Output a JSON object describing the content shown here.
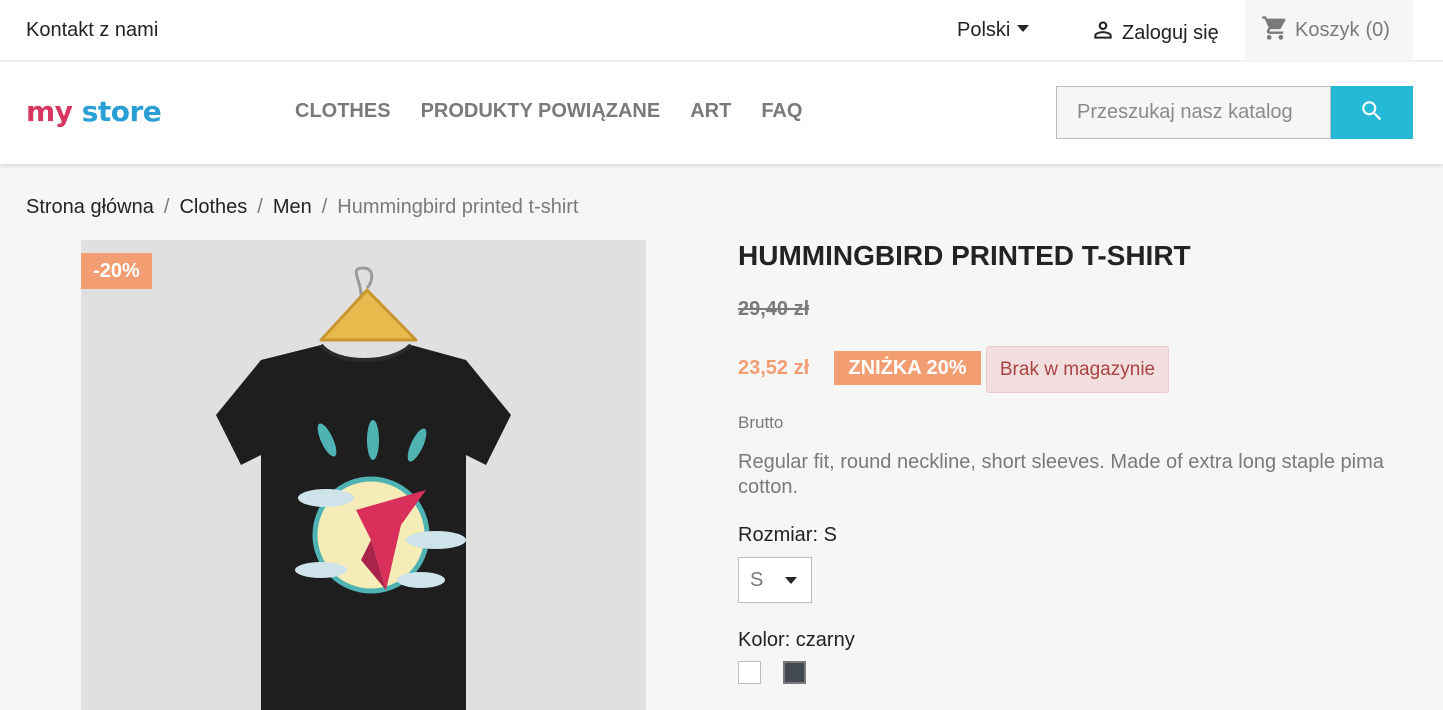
{
  "topbar": {
    "contact_label": "Kontakt z nami",
    "language": "Polski",
    "login_label": "Zaloguj się",
    "cart_label": "Koszyk",
    "cart_count": "(0)"
  },
  "header": {
    "logo": {
      "part1": "my",
      "part2": "store"
    },
    "nav": [
      "CLOTHES",
      "PRODUKTY POWIĄZANE",
      "ART",
      "FAQ"
    ],
    "search_placeholder": "Przeszukaj nasz katalog"
  },
  "breadcrumb": {
    "items": [
      "Strona główna",
      "Clothes",
      "Men"
    ],
    "current": "Hummingbird printed t-shirt",
    "separator": "/"
  },
  "product": {
    "discount_flag": "-20%",
    "title": "Hummingbird printed t-shirt",
    "old_price": "29,40 zł",
    "price": "23,52 zł",
    "save_label": "ZNIŻKA 20%",
    "stock_label": "Brak w magazynie",
    "tax_label": "Brutto",
    "description": "Regular fit, round neckline, short sleeves. Made of extra long staple pima cotton.",
    "size_label": "Rozmiar: S",
    "size_value": "S",
    "color_label": "Kolor: czarny",
    "colors": [
      {
        "name": "white",
        "hex": "#ffffff"
      },
      {
        "name": "black",
        "hex": "#434a54"
      }
    ]
  },
  "colors": {
    "accent": "#24b9d7",
    "discount": "#f39d72",
    "stock_bg": "#f2dede",
    "stock_text": "#a94442"
  }
}
